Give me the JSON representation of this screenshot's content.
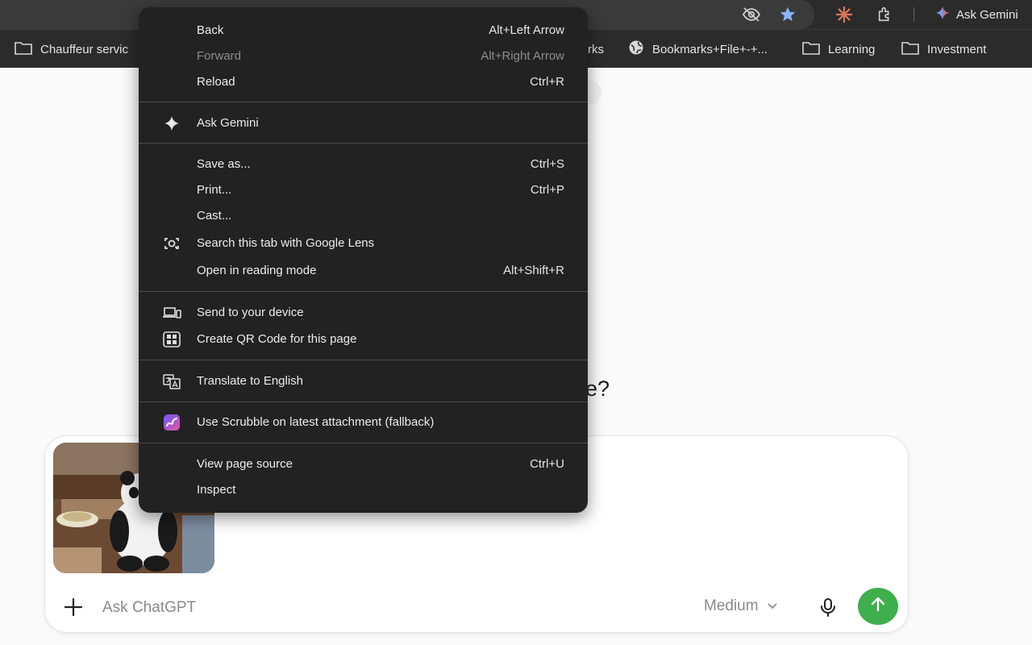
{
  "toolbar": {
    "ask_gemini_label": "Ask Gemini"
  },
  "bookmarks": [
    {
      "label": "Chauffeur servic",
      "icon": "folder-icon"
    },
    {
      "label": "rks",
      "icon": ""
    },
    {
      "label": "Bookmarks+File+-+...",
      "icon": "globe-icon"
    },
    {
      "label": "Learning",
      "icon": "folder-icon"
    },
    {
      "label": "Investment",
      "icon": "folder-icon"
    }
  ],
  "page": {
    "question_tail": "e?",
    "composer": {
      "placeholder": "Ask ChatGPT",
      "model": "Medium"
    }
  },
  "context_menu": {
    "items": [
      {
        "label": "Back",
        "shortcut": "Alt+Left Arrow"
      },
      {
        "label": "Forward",
        "shortcut": "Alt+Right Arrow",
        "disabled": true
      },
      {
        "label": "Reload",
        "shortcut": "Ctrl+R"
      },
      {
        "label": "Ask Gemini",
        "icon": "sparkle-icon"
      },
      {
        "label": "Save as...",
        "shortcut": "Ctrl+S"
      },
      {
        "label": "Print...",
        "shortcut": "Ctrl+P"
      },
      {
        "label": "Cast..."
      },
      {
        "label": "Search this tab with Google Lens",
        "icon": "google-lens-icon"
      },
      {
        "label": "Open in reading mode",
        "shortcut": "Alt+Shift+R"
      },
      {
        "label": "Send to your device",
        "icon": "devices-icon"
      },
      {
        "label": "Create QR Code for this page",
        "icon": "qr-code-icon"
      },
      {
        "label": "Translate to English",
        "icon": "translate-icon"
      },
      {
        "label": "Use Scrubble on latest attachment (fallback)",
        "icon": "scrubble-icon"
      },
      {
        "label": "View page source",
        "shortcut": "Ctrl+U"
      },
      {
        "label": "Inspect"
      }
    ]
  },
  "colors": {
    "menu_bg": "#222222",
    "toolbar_bg": "#2b2b2b",
    "send_button": "#3fae4d",
    "star_accent": "#8ab4f8",
    "claude_orange": "#d97757"
  }
}
